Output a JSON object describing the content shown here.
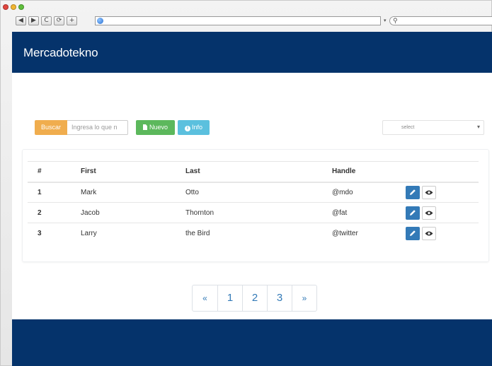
{
  "browser": {
    "nav_buttons": [
      "◀",
      "▶",
      "C",
      "⟳",
      "+"
    ],
    "search_icon": "magnifier-icon"
  },
  "navbar": {
    "brand": "Mercadotekno"
  },
  "controls": {
    "search_button": "Buscar",
    "search_placeholder": "Ingresa lo que n",
    "new_button": "Nuevo",
    "info_button": "Info",
    "select_value": "select"
  },
  "table": {
    "headers": [
      "#",
      "First",
      "Last",
      "Handle"
    ],
    "rows": [
      {
        "num": "1",
        "first": "Mark",
        "last": "Otto",
        "handle": "@mdo"
      },
      {
        "num": "2",
        "first": "Jacob",
        "last": "Thornton",
        "handle": "@fat"
      },
      {
        "num": "3",
        "first": "Larry",
        "last": "the Bird",
        "handle": "@twitter"
      }
    ]
  },
  "pagination": [
    "«",
    "1",
    "2",
    "3",
    "»"
  ],
  "colors": {
    "navbar": "#05336b",
    "buscar": "#f0ad4e",
    "nuevo": "#5cb85c",
    "info": "#5bc0de",
    "primary": "#337ab7"
  }
}
